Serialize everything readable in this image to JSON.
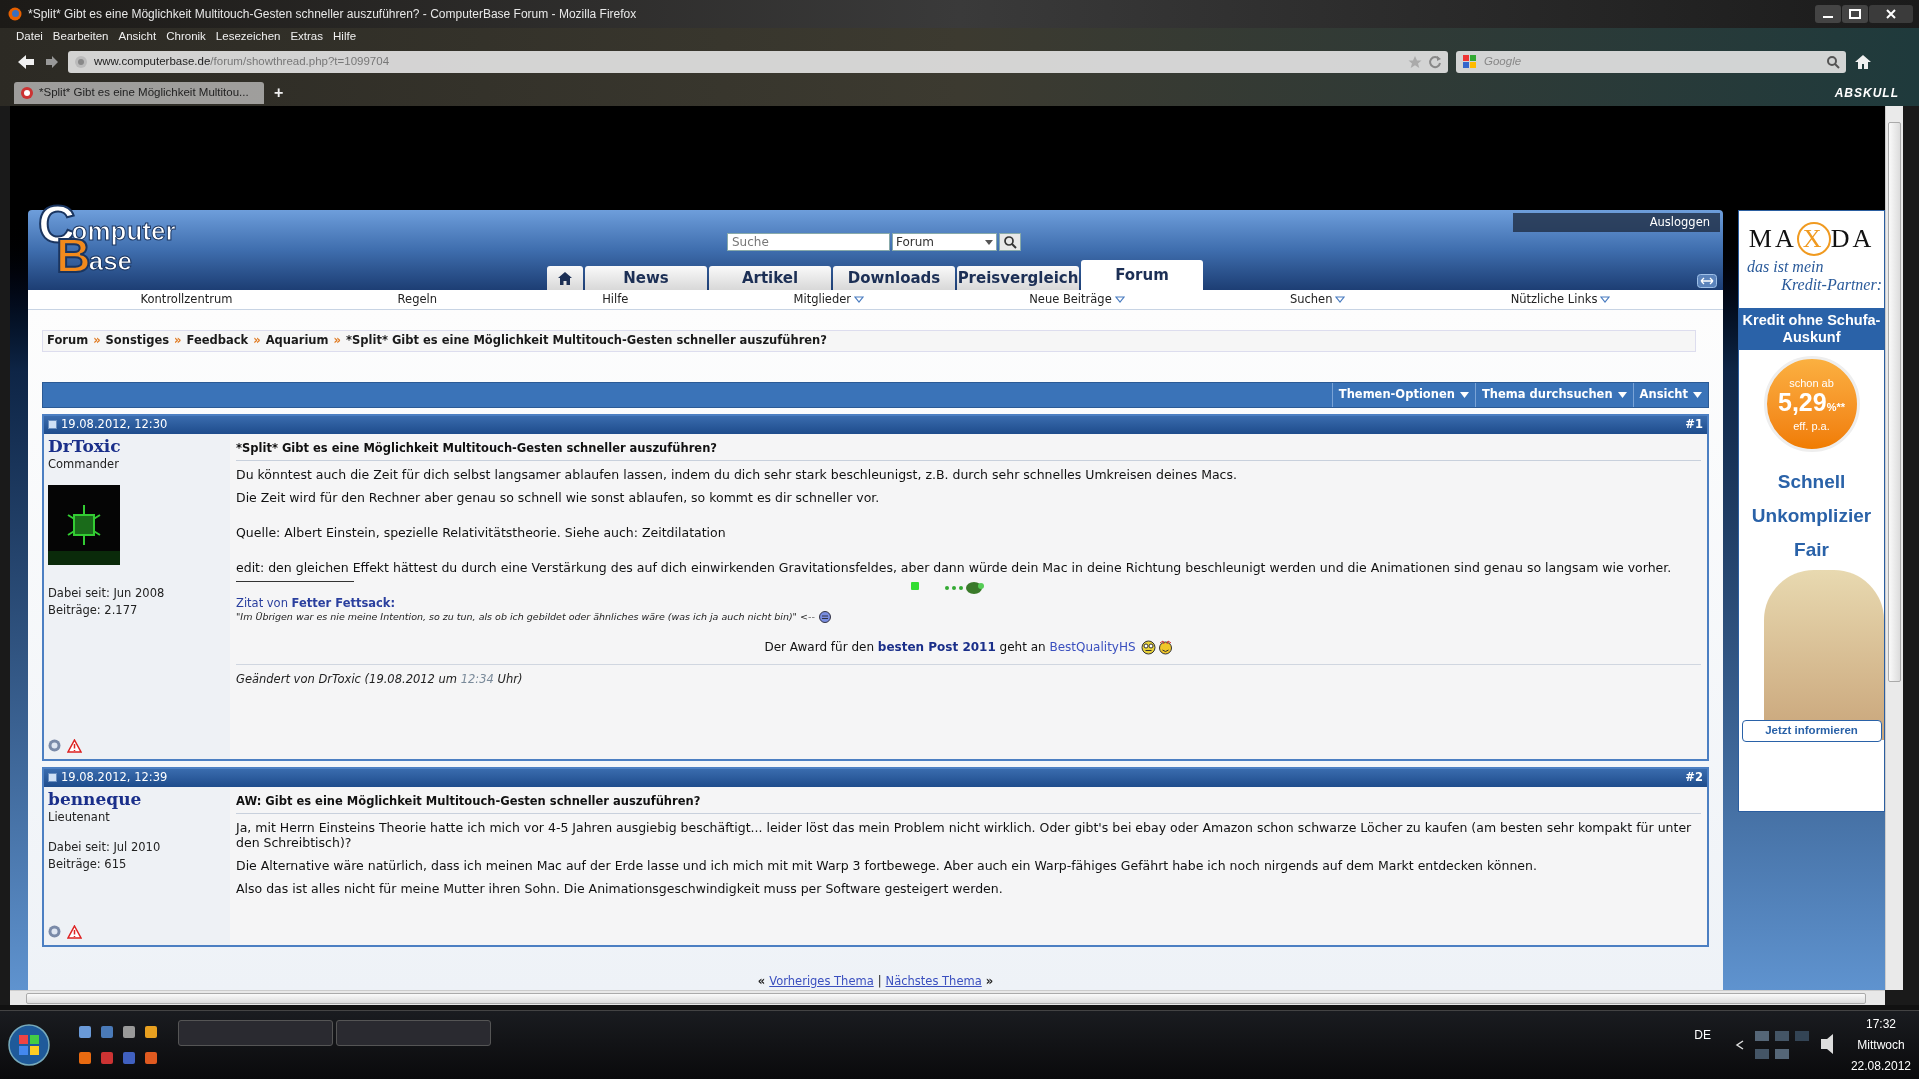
{
  "window": {
    "title": "*Split* Gibt es eine Möglichkeit Multitouch-Gesten schneller auszuführen? - ComputerBase Forum - Mozilla Firefox"
  },
  "menu_bar": [
    "Datei",
    "Bearbeiten",
    "Ansicht",
    "Chronik",
    "Lesezeichen",
    "Extras",
    "Hilfe"
  ],
  "address_bar": {
    "url_host": "www.computerbase.de",
    "url_path": "/forum/showthread.php?t=1099704",
    "search_placeholder": "Google"
  },
  "tabs": [
    {
      "label": "*Split* Gibt es eine Möglichkeit Multitou...",
      "selected": true
    }
  ],
  "new_tab": "+",
  "theme_label": "ABSKULL",
  "site": {
    "logo": {
      "first": "C",
      "first_rest": "omputer",
      "second": "B",
      "second_rest": "ase"
    },
    "search": {
      "placeholder": "Suche",
      "scope": "Forum"
    },
    "logout": "Ausloggen",
    "nav_tabs": [
      {
        "kind": "home",
        "selected": false
      },
      {
        "kind": "text",
        "label": "News",
        "selected": false
      },
      {
        "kind": "text",
        "label": "Artikel",
        "selected": false
      },
      {
        "kind": "text",
        "label": "Downloads",
        "selected": false
      },
      {
        "kind": "text",
        "label": "Preisvergleich",
        "selected": false
      },
      {
        "kind": "text",
        "label": "Forum",
        "selected": true
      }
    ],
    "subnav": [
      {
        "label": "Kontrollzentrum",
        "dropdown": false
      },
      {
        "label": "Regeln",
        "dropdown": false
      },
      {
        "label": "Hilfe",
        "dropdown": false
      },
      {
        "label": "Mitglieder",
        "dropdown": true
      },
      {
        "label": "Neue Beiträge",
        "dropdown": true
      },
      {
        "label": "Suchen",
        "dropdown": true
      },
      {
        "label": "Nützliche Links",
        "dropdown": true
      }
    ]
  },
  "breadcrumb": {
    "separator": "»",
    "items": [
      "Forum",
      "Sonstiges",
      "Feedback",
      "Aquarium",
      "*Split* Gibt es eine Möglichkeit Multitouch-Gesten schneller auszuführen?"
    ]
  },
  "thread_tools": [
    "Themen-Optionen",
    "Thema durchsuchen",
    "Ansicht"
  ],
  "posts": [
    {
      "date": "19.08.2012, 12:30",
      "number": "#1",
      "author": "DrToxic",
      "rank": "Commander",
      "has_avatar": true,
      "joined": "Dabei seit: Jun 2008",
      "post_count": "Beiträge: 2.177",
      "title": "*Split* Gibt es eine Möglichkeit Multitouch-Gesten schneller auszuführen?",
      "paragraphs": [
        "Du könntest auch die Zeit für dich selbst langsamer ablaufen lassen, indem du dich sehr stark beschleunigst, z.B. durch sehr schnelles Umkreisen deines Macs.",
        "Die Zeit wird für den Rechner aber genau so schnell wie sonst ablaufen, so kommt es dir schneller vor.",
        "Quelle: Albert Einstein, spezielle Relativitätstheorie. Siehe auch: Zeitdilatation",
        "edit: den gleichen Effekt hättest du durch eine Verstärkung des auf dich einwirkenden Gravitationsfeldes, aber dann würde dein Mac in deine Richtung beschleunigt werden und die Animationen sind genau so langsam wie vorher."
      ],
      "signature": {
        "quote_heading": "Zitat von **Fetter Fettsack:**",
        "quote": "\"Im Übrigen war es nie meine Intention, so zu tun, als ob ich gebildet oder ähnliches wäre (was ich ja auch nicht bin)\" <--",
        "award": "Der Award für den **besten Post 2011** geht an",
        "award_link": "BestQualityHS"
      },
      "edit_note": {
        "before": "Geändert von DrToxic (19.08.2012 um",
        "time": "12:34",
        "after": "Uhr)"
      }
    },
    {
      "date": "19.08.2012, 12:39",
      "number": "#2",
      "author": "benneque",
      "rank": "Lieutenant",
      "has_avatar": false,
      "joined": "Dabei seit: Jul 2010",
      "post_count": "Beiträge: 615",
      "title": "AW: Gibt es eine Möglichkeit Multitouch-Gesten schneller auszuführen?",
      "paragraphs": [
        "Ja, mit Herrn Einsteins Theorie hatte ich mich vor 4-5 Jahren ausgiebig beschäftigt... leider löst das mein Problem nicht wirklich. Oder gibt's bei ebay oder Amazon schon schwarze Löcher zu kaufen (am besten sehr kompakt für unter den Schreibtisch)?",
        "Die Alternative wäre natürlich, dass ich meinen Mac auf der Erde lasse und ich mich mit mit Warp 3 fortbewege. Aber auch ein Warp-fähiges Gefährt habe ich noch nirgends auf dem Markt entdecken können.",
        "Also das ist alles nicht für meine Mutter ihren Sohn. Die Animationsgeschwindigkeit muss per Software gesteigert werden."
      ]
    }
  ],
  "thread_nav": {
    "prev_mark": "«",
    "prev": "Vorheriges Thema",
    "separator": "|",
    "next": "Nächstes Thema",
    "next_mark": "»"
  },
  "ad": {
    "brand_left": "MA",
    "brand_mark": "X",
    "brand_right": "DA",
    "slogan_1": "das ist mein",
    "slogan_2": "Kredit-Partner:",
    "band": "Kredit ohne Schufa-Auskunf",
    "rate_top": "schon ab",
    "rate": "5,29",
    "rate_unit": "%**",
    "rate_bottom": "eff. p.a.",
    "claims": [
      "Schnell",
      "Unkomplizier",
      "Fair"
    ],
    "cta": "Jetzt informieren"
  },
  "taskbar": {
    "language": "DE",
    "time": "17:32",
    "day": "Mittwoch",
    "date": "22.08.2012"
  }
}
